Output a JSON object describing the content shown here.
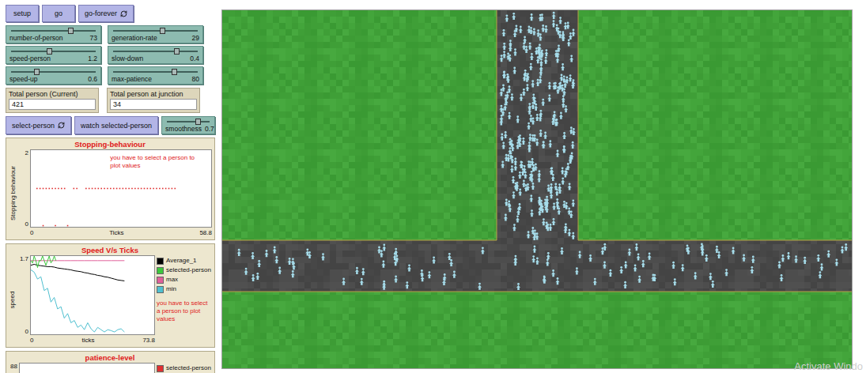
{
  "buttons": [
    {
      "label": "setup",
      "forever": false
    },
    {
      "label": "go",
      "forever": false
    },
    {
      "label": "go-forever",
      "forever": true
    }
  ],
  "sliders": [
    {
      "label": "number-of-person",
      "value": "73",
      "level": 0.7
    },
    {
      "label": "generation-rate",
      "value": "29",
      "level": 0.58
    },
    {
      "label": "speed-person",
      "value": "1.2",
      "level": 0.45
    },
    {
      "label": "slow-down",
      "value": "0.4",
      "level": 0.75
    },
    {
      "label": "speed-up",
      "value": "0.6",
      "level": 0.3
    },
    {
      "label": "max-patience",
      "value": "80",
      "level": 0.72
    }
  ],
  "monitors": [
    {
      "label": "Total person (Current)",
      "value": "421"
    },
    {
      "label": "Total person at junction",
      "value": "34"
    }
  ],
  "selection_row": {
    "buttons": [
      {
        "label": "select-person",
        "forever": true
      },
      {
        "label": "watch selected-person",
        "forever": false
      }
    ],
    "slider": {
      "label": "smoothness",
      "value": "0.7",
      "level": 0.72
    }
  },
  "plots": [
    {
      "title": "Stopping-behaviour",
      "y_label": "Stopping behaviour",
      "x_label": "Ticks",
      "x_min": "0",
      "x_max": "58.8",
      "y_min": "0",
      "y_max": "2",
      "x_range": 58.8,
      "y_range": 2,
      "note": "you have to select a person to plot values",
      "legend": [],
      "series": [
        {
          "name": "stop",
          "kind": "dots",
          "color": "#e03030",
          "start": 2,
          "step": 1,
          "values": [
            1,
            1,
            1,
            1,
            1,
            1,
            1,
            1,
            1,
            1,
            null,
            null,
            1,
            1,
            null,
            null,
            1,
            1,
            1,
            1,
            1,
            1,
            1,
            1,
            1,
            1,
            1,
            1,
            1,
            1,
            1,
            1,
            1,
            1,
            1,
            1,
            1,
            1,
            1,
            1,
            1,
            1,
            1,
            1,
            1,
            1
          ]
        },
        {
          "name": "moving",
          "kind": "dots",
          "color": "#e03030",
          "start": 4,
          "step": 4,
          "values": [
            0.03,
            0.03,
            0.03
          ]
        }
      ]
    },
    {
      "title": "Speed V/s Ticks",
      "y_label": "speed",
      "x_label": "ticks",
      "x_min": "0",
      "x_max": "73.8",
      "y_min": "0",
      "y_max": "1.7",
      "x_range": 73.8,
      "y_range": 1.7,
      "note": "you have to select a person to plot values",
      "legend": [
        {
          "label": "Average_1",
          "color": "#000000"
        },
        {
          "label": "selected-person",
          "color": "#3cc83c"
        },
        {
          "label": "max",
          "color": "#e0609a"
        },
        {
          "label": "min",
          "color": "#4fc0d0"
        }
      ],
      "series": [
        {
          "name": "Average_1",
          "kind": "line",
          "color": "#000000",
          "start": 0,
          "step": 2,
          "values": [
            1.5,
            1.52,
            1.5,
            1.49,
            1.48,
            1.47,
            1.47,
            1.46,
            1.44,
            1.43,
            1.42,
            1.41,
            1.4,
            1.38,
            1.37,
            1.36,
            1.34,
            1.33,
            1.31,
            1.3,
            1.28,
            1.27,
            1.25,
            1.24,
            1.22,
            1.2,
            1.18,
            1.17,
            1.16
          ]
        },
        {
          "name": "max",
          "kind": "line",
          "color": "#e0609a",
          "start": 0,
          "step": 4,
          "values": [
            1.6,
            1.6,
            1.6,
            1.6,
            1.6,
            1.6,
            1.6,
            1.6,
            1.6,
            1.6,
            1.6,
            1.6,
            1.6,
            1.6,
            1.6
          ]
        },
        {
          "name": "selected-person",
          "kind": "line",
          "color": "#3cc83c",
          "start": 0,
          "step": 1,
          "values": [
            1.6,
            1.55,
            1.7,
            1.6,
            1.45,
            1.6,
            1.6,
            1.7,
            1.6,
            1.5,
            1.6,
            1.7,
            1.55,
            1.6,
            1.7,
            1.6
          ]
        },
        {
          "name": "min",
          "kind": "line",
          "color": "#4fc0d0",
          "start": 0,
          "step": 2,
          "values": [
            1.4,
            1.35,
            1.2,
            1.25,
            0.95,
            1.0,
            0.7,
            0.8,
            0.55,
            0.6,
            0.35,
            0.45,
            0.25,
            0.3,
            0.15,
            0.2,
            0.1,
            0.25,
            0.12,
            0.05,
            0.15,
            0.1,
            0.05,
            0.1,
            0.08,
            0.05,
            0.1,
            0.12,
            0.05
          ]
        }
      ]
    },
    {
      "title": "patience-level",
      "y_max": "88",
      "x_range": 10,
      "y_range": 88,
      "legend": [
        {
          "label": "selected-person",
          "color": "#e03030"
        },
        {
          "color": "#e8d020"
        }
      ],
      "series": []
    }
  ],
  "world": {
    "persons_vertical": 260,
    "persons_horizontal": 110
  },
  "watermark": "Activate Windo"
}
